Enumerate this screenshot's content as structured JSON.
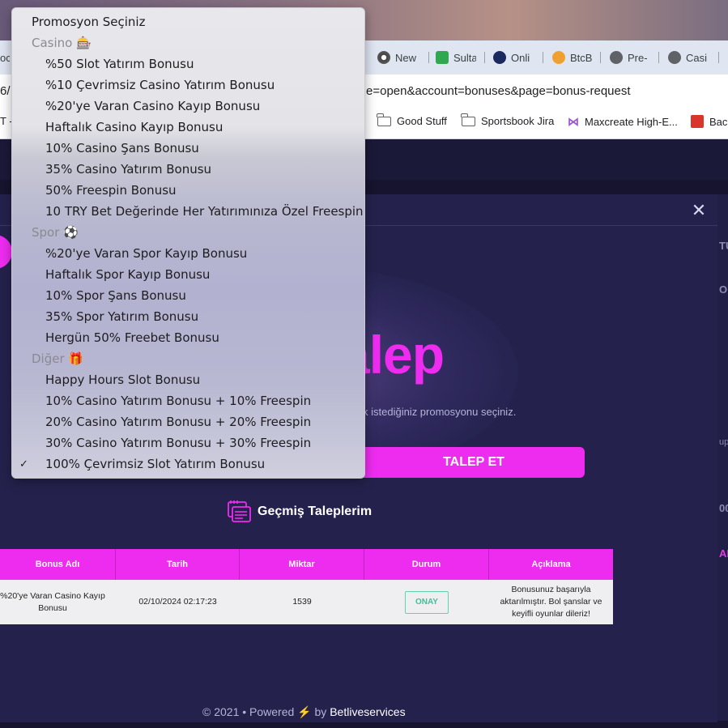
{
  "browser": {
    "tabs": [
      {
        "label": "oc"
      },
      {
        "label": "New"
      },
      {
        "label": "Sulta"
      },
      {
        "label": "Onli"
      },
      {
        "label": "BtcB"
      },
      {
        "label": "Pre-"
      },
      {
        "label": "Casi"
      }
    ],
    "url_prefix": "6/",
    "url": "e=open&account=bonuses&page=bonus-request",
    "bookmarks": [
      {
        "label": "T -"
      },
      {
        "label": "Good Stuff"
      },
      {
        "label": "Sportsbook Jira"
      },
      {
        "label": "Maxcreate High-E..."
      },
      {
        "label": "Back"
      }
    ]
  },
  "modal": {
    "close_symbol": "✕",
    "title_partial": "alep",
    "subtitle_partial": "k istediğiniz promosyonu seçiniz.",
    "request_button": "TALEP ET",
    "history_label": "Geçmiş Taleplerim",
    "table": {
      "headers": [
        "Bonus Adı",
        "Tarih",
        "Miktar",
        "Durum",
        "Açıklama"
      ],
      "rows": [
        {
          "bonus": "%20'ye Varan Casino Kayıp Bonusu",
          "date": "02/10/2024 02:17:23",
          "amount": "1539",
          "status": "ONAY",
          "description": "Bonusunuz başarıyla aktarılmıştır. Bol şanslar ve keyifli oyunlar dileriz!"
        }
      ]
    },
    "footer": {
      "prefix": "© 2021 • Powered",
      "bolt": "⚡",
      "by": "by",
      "brand": "Betliveservices"
    }
  },
  "right_peek": {
    "a": "TU",
    "b": "OF",
    "c": "up",
    "d": "00",
    "e": "AH"
  },
  "dropdown": {
    "placeholder": "Promosyon Seçiniz",
    "groups": [
      {
        "label": "Casino 🎰",
        "options": [
          "%50 Slot Yatırım Bonusu",
          "%10 Çevrimsiz Casino Yatırım Bonusu",
          "%20'ye Varan Casino Kayıp Bonusu",
          "Haftalık Casino Kayıp Bonusu",
          "10% Casino Şans Bonusu",
          "35% Casino Yatırım Bonusu",
          "50% Freespin Bonusu",
          "10 TRY Bet Değerinde Her Yatırımınıza Özel Freespin"
        ]
      },
      {
        "label": "Spor ⚽",
        "options": [
          "%20'ye Varan Spor Kayıp Bonusu",
          "Haftalık Spor Kayıp Bonusu",
          "10% Spor Şans Bonusu",
          "35% Spor Yatırım Bonusu",
          "Hergün 50% Freebet Bonusu"
        ]
      },
      {
        "label": "Diğer 🎁",
        "options": [
          "Happy Hours Slot Bonusu",
          "10% Casino Yatırım Bonusu + 10% Freespin",
          "20% Casino Yatırım Bonusu + 20% Freespin",
          "30% Casino Yatırım Bonusu + 30% Freespin",
          "100% Çevrimsiz Slot Yatırım Bonusu"
        ]
      }
    ],
    "selected": "100% Çevrimsiz Slot Yatırım Bonusu",
    "check_symbol": "✓"
  }
}
